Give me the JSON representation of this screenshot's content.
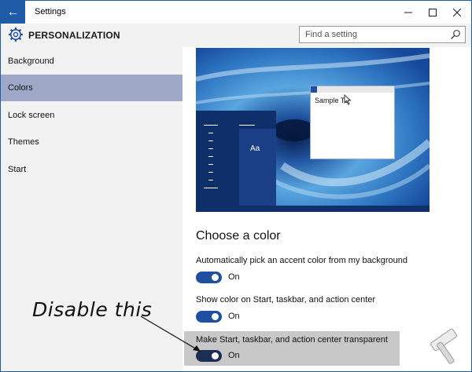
{
  "window": {
    "title": "Settings",
    "back_icon": "back-arrow-icon",
    "minimize_icon": "minimize-icon",
    "maximize_icon": "maximize-icon",
    "close_icon": "close-icon",
    "accent_color": "#1f5ba6"
  },
  "header": {
    "icon": "gear-icon",
    "title": "PERSONALIZATION",
    "search_placeholder": "Find a setting",
    "search_icon": "search-icon"
  },
  "sidebar": {
    "items": [
      {
        "label": "Background",
        "active": false
      },
      {
        "label": "Colors",
        "active": true
      },
      {
        "label": "Lock screen",
        "active": false
      },
      {
        "label": "Themes",
        "active": false
      },
      {
        "label": "Start",
        "active": false
      }
    ],
    "active_color": "#9da9c7"
  },
  "preview": {
    "tile_label": "Aa",
    "sample_text": "Sample Te",
    "cursor_icon": "mouse-pointer-icon"
  },
  "colors_section": {
    "title": "Choose a color",
    "settings": [
      {
        "label": "Automatically pick an accent color from my background",
        "state": "On"
      },
      {
        "label": "Show color on Start, taskbar, and action center",
        "state": "On"
      },
      {
        "label": "Make Start, taskbar, and action center transparent",
        "state": "On"
      }
    ]
  },
  "annotation": {
    "text": "Disable this"
  },
  "logo": {
    "icon": "hammer-logo-icon"
  }
}
